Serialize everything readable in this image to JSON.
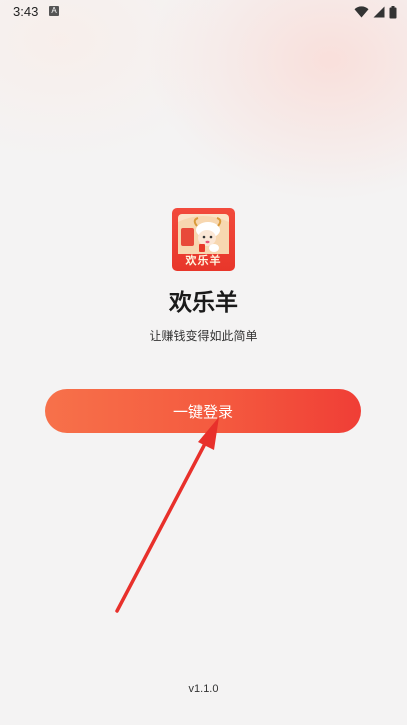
{
  "status_bar": {
    "time": "3:43",
    "notification_letter": "A",
    "icons": [
      "wifi-icon",
      "signal-icon",
      "battery-icon"
    ]
  },
  "app": {
    "logo_text": "欢乐羊",
    "name": "欢乐羊",
    "slogan": "让赚钱变得如此简单"
  },
  "login": {
    "button_label": "一键登录"
  },
  "annotation": {
    "icon": "red-arrow-icon",
    "color": "#e8302b"
  },
  "footer": {
    "version": "v1.1.0"
  },
  "colors": {
    "button_start": "#f7714a",
    "button_end": "#f03e36",
    "logo_red": "#e8362a",
    "background": "#f4f3f3"
  }
}
